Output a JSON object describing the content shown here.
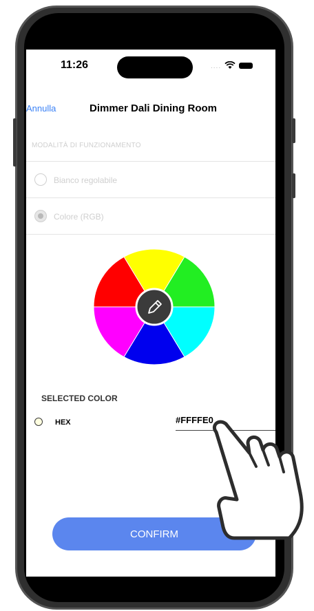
{
  "status_bar": {
    "time": "11:26",
    "signal": "....",
    "wifi_icon": "wifi-icon",
    "battery_icon": "battery-icon"
  },
  "nav": {
    "cancel_label": "Annulla",
    "title": "Dimmer Dali Dining Room"
  },
  "mode": {
    "section_label": "MODALITÀ DI FUNZIONAMENTO",
    "options": [
      {
        "label": "Bianco regolabile",
        "selected": false
      },
      {
        "label": "Colore (RGB)",
        "selected": true
      }
    ]
  },
  "color_wheel": {
    "segments": [
      "#ffff00",
      "#22ee22",
      "#00ffff",
      "#0000ee",
      "#ff00ff",
      "#ff0000"
    ],
    "center_icon": "pencil-icon"
  },
  "selected_color": {
    "title": "SELECTED COLOR",
    "format_label": "HEX",
    "value": "#FFFFE0",
    "swatch_color": "#FFFFE0"
  },
  "confirm_label": "CONFIRM",
  "colors": {
    "accent": "#5b86ee",
    "link": "#3b82f6"
  }
}
